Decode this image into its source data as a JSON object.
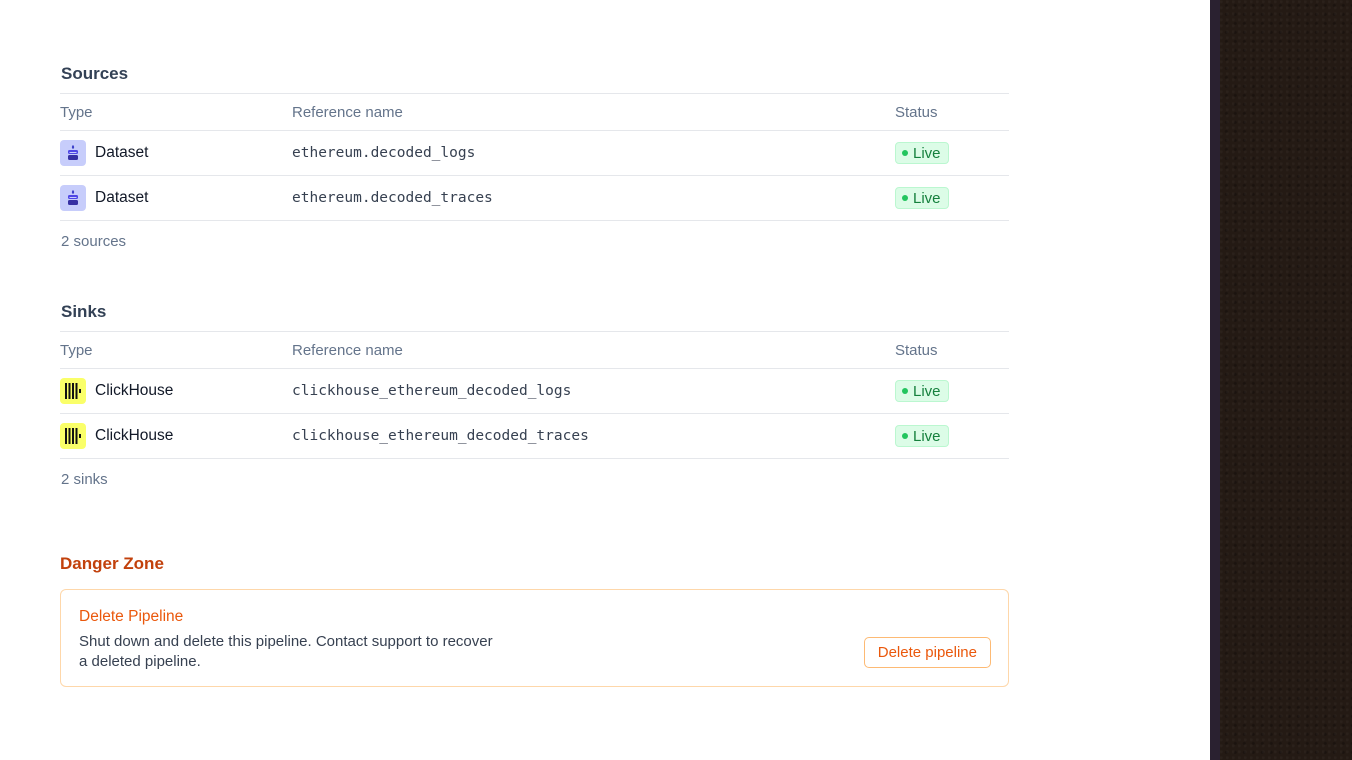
{
  "sources": {
    "title": "Sources",
    "columns": {
      "type": "Type",
      "reference": "Reference name",
      "status": "Status"
    },
    "rows": [
      {
        "type": "Dataset",
        "icon": "dataset-icon",
        "reference": "ethereum.decoded_logs",
        "status": "Live"
      },
      {
        "type": "Dataset",
        "icon": "dataset-icon",
        "reference": "ethereum.decoded_traces",
        "status": "Live"
      }
    ],
    "count": "2 sources"
  },
  "sinks": {
    "title": "Sinks",
    "columns": {
      "type": "Type",
      "reference": "Reference name",
      "status": "Status"
    },
    "rows": [
      {
        "type": "ClickHouse",
        "icon": "clickhouse-icon",
        "reference": "clickhouse_ethereum_decoded_logs",
        "status": "Live"
      },
      {
        "type": "ClickHouse",
        "icon": "clickhouse-icon",
        "reference": "clickhouse_ethereum_decoded_traces",
        "status": "Live"
      }
    ],
    "count": "2 sinks"
  },
  "danger_zone": {
    "title": "Danger Zone",
    "heading": "Delete Pipeline",
    "description": "Shut down and delete this pipeline. Contact support to recover a deleted pipeline.",
    "button_label": "Delete pipeline"
  },
  "colors": {
    "danger": "#c2410c",
    "live_green": "#15803d",
    "clickhouse_yellow": "#faff69",
    "dataset_purple": "#c7cdfb"
  }
}
